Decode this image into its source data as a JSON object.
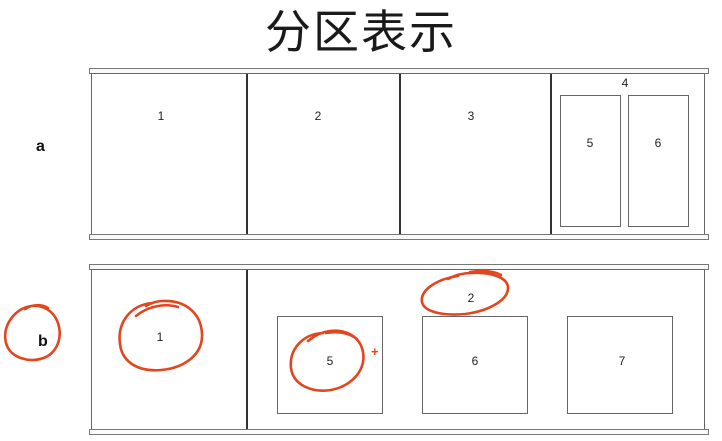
{
  "title": "分区表示",
  "row_a": {
    "label": "a",
    "partitions": [
      "1",
      "2",
      "3",
      "4"
    ],
    "sub_partitions": [
      "5",
      "6"
    ]
  },
  "row_b": {
    "label": "b",
    "partitions": [
      "1",
      "2"
    ],
    "sub_partitions": [
      "5",
      "6",
      "7"
    ],
    "plus_mark": "+"
  },
  "annotation_color": "#e2461e"
}
